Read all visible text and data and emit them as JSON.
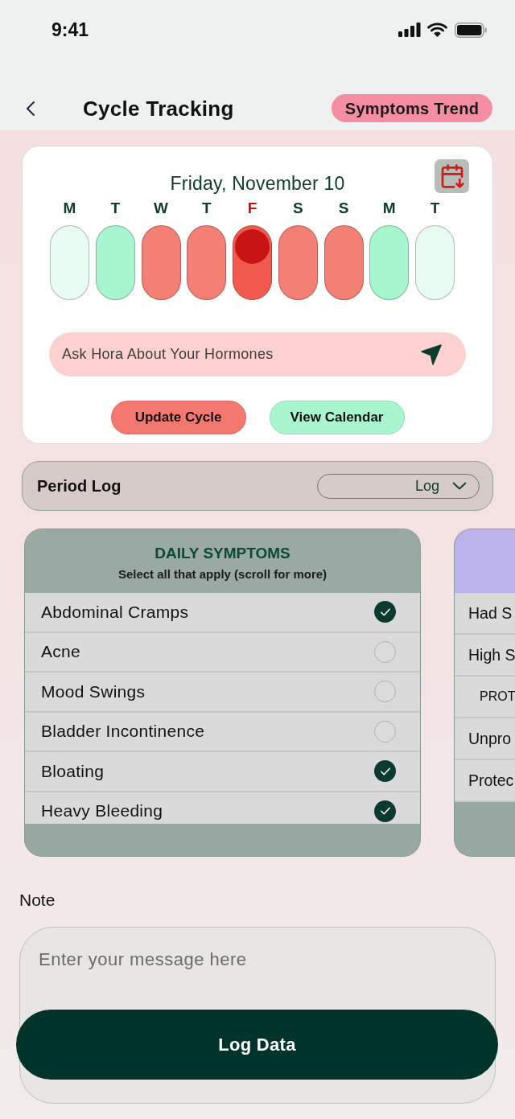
{
  "status_bar": {
    "time": "9:41"
  },
  "header": {
    "title": "Cycle Tracking",
    "action": "Symptoms Trend"
  },
  "calendar": {
    "date": "Friday, November 10",
    "days": [
      {
        "letter": "M",
        "color": "#e8fcf1",
        "selected": false
      },
      {
        "letter": "T",
        "color": "#a7f6cf",
        "selected": false
      },
      {
        "letter": "W",
        "color": "#f47f75",
        "selected": false
      },
      {
        "letter": "T",
        "color": "#f47f75",
        "selected": false
      },
      {
        "letter": "F",
        "color": "#f25a4e",
        "selected": true
      },
      {
        "letter": "S",
        "color": "#f47f75",
        "selected": false
      },
      {
        "letter": "S",
        "color": "#f47f75",
        "selected": false
      },
      {
        "letter": "M",
        "color": "#a7f6cf",
        "selected": false
      },
      {
        "letter": "T",
        "color": "#e8fcf1",
        "selected": false
      }
    ],
    "ask": {
      "placeholder": "Ask Hora About Your Hormones"
    },
    "actions": [
      {
        "label": "Update Cycle",
        "color": "#f47870"
      },
      {
        "label": "View Calendar",
        "color": "#a8f5cf"
      }
    ]
  },
  "period_log": {
    "title": "Period Log",
    "dropdown": {
      "value": "Log"
    }
  },
  "symptom_cards": [
    {
      "title": "DAILY SYMPTOMS",
      "subtitle": "Select all that apply (scroll for more)",
      "color": "#9aa9a4",
      "items": [
        {
          "kind": "check",
          "label": "Abdominal Cramps",
          "checked": true
        },
        {
          "kind": "check",
          "label": "Acne",
          "checked": false
        },
        {
          "kind": "check",
          "label": "Mood Swings",
          "checked": false
        },
        {
          "kind": "check",
          "label": "Bladder Incontinence",
          "checked": false
        },
        {
          "kind": "check",
          "label": "Bloating",
          "checked": true
        },
        {
          "kind": "check",
          "label": "Heavy Bleeding",
          "checked": true
        }
      ]
    },
    {
      "color": "#bdb3ec",
      "items": [
        {
          "kind": "row",
          "label": "Had S"
        },
        {
          "kind": "row",
          "label": "High S"
        },
        {
          "kind": "section",
          "label": "PROT"
        },
        {
          "kind": "row",
          "label": "Unpro"
        },
        {
          "kind": "row",
          "label": "Protec"
        }
      ]
    }
  ],
  "note": {
    "label": "Note",
    "placeholder": "Enter your message here"
  },
  "submit": {
    "label": "Log Data"
  }
}
